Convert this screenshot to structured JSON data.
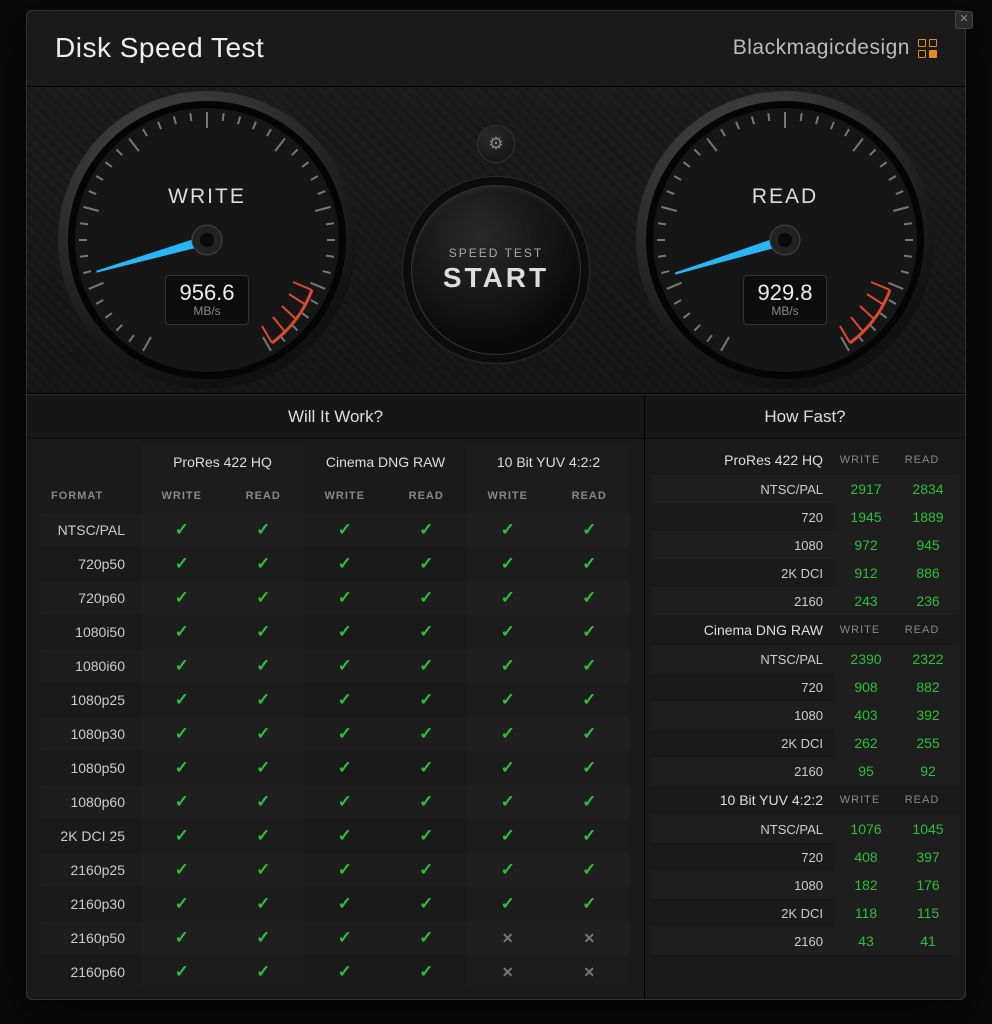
{
  "header": {
    "title": "Disk Speed Test",
    "brand": "Blackmagicdesign"
  },
  "gauges": {
    "write": {
      "label": "WRITE",
      "value": "956.6",
      "unit": "MB/s",
      "needle_angle": 164
    },
    "read": {
      "label": "READ",
      "value": "929.8",
      "unit": "MB/s",
      "needle_angle": 163
    }
  },
  "controls": {
    "start_sub": "SPEED TEST",
    "start_main": "START"
  },
  "panels": {
    "wiw_title": "Will It Work?",
    "hf_title": "How Fast?"
  },
  "wiw": {
    "format_header": "FORMAT",
    "sub_write": "WRITE",
    "sub_read": "READ",
    "groups": [
      "ProRes 422 HQ",
      "Cinema DNG RAW",
      "10 Bit YUV 4:2:2"
    ],
    "rows": [
      {
        "format": "NTSC/PAL",
        "cells": [
          true,
          true,
          true,
          true,
          true,
          true
        ]
      },
      {
        "format": "720p50",
        "cells": [
          true,
          true,
          true,
          true,
          true,
          true
        ]
      },
      {
        "format": "720p60",
        "cells": [
          true,
          true,
          true,
          true,
          true,
          true
        ]
      },
      {
        "format": "1080i50",
        "cells": [
          true,
          true,
          true,
          true,
          true,
          true
        ]
      },
      {
        "format": "1080i60",
        "cells": [
          true,
          true,
          true,
          true,
          true,
          true
        ]
      },
      {
        "format": "1080p25",
        "cells": [
          true,
          true,
          true,
          true,
          true,
          true
        ]
      },
      {
        "format": "1080p30",
        "cells": [
          true,
          true,
          true,
          true,
          true,
          true
        ]
      },
      {
        "format": "1080p50",
        "cells": [
          true,
          true,
          true,
          true,
          true,
          true
        ]
      },
      {
        "format": "1080p60",
        "cells": [
          true,
          true,
          true,
          true,
          true,
          true
        ]
      },
      {
        "format": "2K DCI 25",
        "cells": [
          true,
          true,
          true,
          true,
          true,
          true
        ]
      },
      {
        "format": "2160p25",
        "cells": [
          true,
          true,
          true,
          true,
          true,
          true
        ]
      },
      {
        "format": "2160p30",
        "cells": [
          true,
          true,
          true,
          true,
          true,
          true
        ]
      },
      {
        "format": "2160p50",
        "cells": [
          true,
          true,
          true,
          true,
          false,
          false
        ]
      },
      {
        "format": "2160p60",
        "cells": [
          true,
          true,
          true,
          true,
          false,
          false
        ]
      }
    ]
  },
  "hf": {
    "sub_write": "WRITE",
    "sub_read": "READ",
    "groups": [
      {
        "name": "ProRes 422 HQ",
        "rows": [
          {
            "format": "NTSC/PAL",
            "write": "2917",
            "read": "2834"
          },
          {
            "format": "720",
            "write": "1945",
            "read": "1889"
          },
          {
            "format": "1080",
            "write": "972",
            "read": "945"
          },
          {
            "format": "2K DCI",
            "write": "912",
            "read": "886"
          },
          {
            "format": "2160",
            "write": "243",
            "read": "236"
          }
        ]
      },
      {
        "name": "Cinema DNG RAW",
        "rows": [
          {
            "format": "NTSC/PAL",
            "write": "2390",
            "read": "2322"
          },
          {
            "format": "720",
            "write": "908",
            "read": "882"
          },
          {
            "format": "1080",
            "write": "403",
            "read": "392"
          },
          {
            "format": "2K DCI",
            "write": "262",
            "read": "255"
          },
          {
            "format": "2160",
            "write": "95",
            "read": "92"
          }
        ]
      },
      {
        "name": "10 Bit YUV 4:2:2",
        "rows": [
          {
            "format": "NTSC/PAL",
            "write": "1076",
            "read": "1045"
          },
          {
            "format": "720",
            "write": "408",
            "read": "397"
          },
          {
            "format": "1080",
            "write": "182",
            "read": "176"
          },
          {
            "format": "2K DCI",
            "write": "118",
            "read": "115"
          },
          {
            "format": "2160",
            "write": "43",
            "read": "41"
          }
        ]
      }
    ]
  }
}
